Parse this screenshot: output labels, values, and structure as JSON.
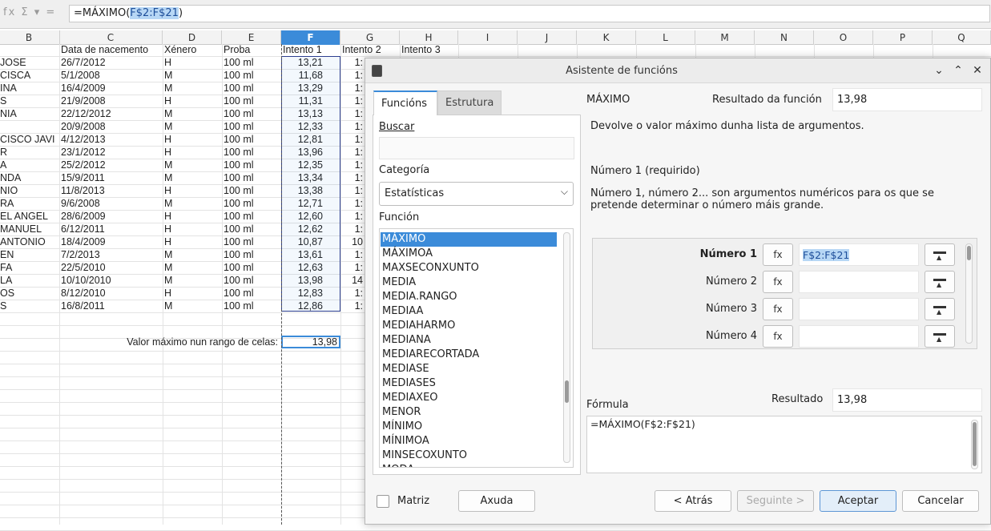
{
  "formula_bar": {
    "icons": "fx Σ ▾ =",
    "prefix": "=MÁXIMO(",
    "ref": "F$2:F$21",
    "suffix": ")"
  },
  "columns": [
    "B",
    "C",
    "D",
    "E",
    "F",
    "G",
    "H",
    "I",
    "J",
    "K",
    "L",
    "M",
    "N",
    "O",
    "P",
    "Q"
  ],
  "selected_column": "F",
  "sheet": {
    "headers": {
      "c": "Data de nacemento",
      "d": "Xénero",
      "e": "Proba",
      "f": "Intento 1",
      "g": "Intento 2",
      "h": "Intento 3"
    },
    "rows": [
      {
        "b": "JOSE",
        "c": "26/7/2012",
        "d": "H",
        "e": "100 ml",
        "f": "13,21",
        "g": "1:"
      },
      {
        "b": "CISCA",
        "c": "5/1/2008",
        "d": "M",
        "e": "100 ml",
        "f": "11,68",
        "g": "1:"
      },
      {
        "b": "INA",
        "c": "16/4/2009",
        "d": "M",
        "e": "100 ml",
        "f": "13,29",
        "g": "1:"
      },
      {
        "b": "S",
        "c": "21/9/2008",
        "d": "H",
        "e": "100 ml",
        "f": "11,31",
        "g": "1:"
      },
      {
        "b": "NIA",
        "c": "22/12/2012",
        "d": "M",
        "e": "100 ml",
        "f": "13,13",
        "g": "1:"
      },
      {
        "b": "",
        "c": "20/9/2008",
        "d": "M",
        "e": "100 ml",
        "f": "12,33",
        "g": "1:"
      },
      {
        "b": "CISCO JAVI",
        "c": "4/12/2013",
        "d": "H",
        "e": "100 ml",
        "f": "12,81",
        "g": "1:"
      },
      {
        "b": "R",
        "c": "23/1/2012",
        "d": "H",
        "e": "100 ml",
        "f": "13,96",
        "g": "1:"
      },
      {
        "b": "A",
        "c": "25/2/2012",
        "d": "M",
        "e": "100 ml",
        "f": "12,35",
        "g": "1:"
      },
      {
        "b": "NDA",
        "c": "15/9/2011",
        "d": "M",
        "e": "100 ml",
        "f": "13,34",
        "g": "1:"
      },
      {
        "b": "NIO",
        "c": "11/8/2013",
        "d": "H",
        "e": "100 ml",
        "f": "13,38",
        "g": "1:"
      },
      {
        "b": "RA",
        "c": "9/6/2008",
        "d": "M",
        "e": "100 ml",
        "f": "12,71",
        "g": "1:"
      },
      {
        "b": "EL ANGEL",
        "c": "28/6/2009",
        "d": "H",
        "e": "100 ml",
        "f": "12,60",
        "g": "1:"
      },
      {
        "b": "MANUEL",
        "c": "6/12/2011",
        "d": "H",
        "e": "100 ml",
        "f": "12,62",
        "g": "1:"
      },
      {
        "b": "ANTONIO",
        "c": "18/4/2009",
        "d": "H",
        "e": "100 ml",
        "f": "10,87",
        "g": "10"
      },
      {
        "b": "EN",
        "c": "7/2/2013",
        "d": "M",
        "e": "100 ml",
        "f": "13,61",
        "g": "1:"
      },
      {
        "b": "FA",
        "c": "22/5/2010",
        "d": "M",
        "e": "100 ml",
        "f": "12,63",
        "g": "1:"
      },
      {
        "b": "LA",
        "c": "10/10/2010",
        "d": "M",
        "e": "100 ml",
        "f": "13,98",
        "g": "14"
      },
      {
        "b": "OS",
        "c": "8/12/2010",
        "d": "H",
        "e": "100 ml",
        "f": "12,83",
        "g": "1:"
      },
      {
        "b": "S",
        "c": "16/8/2011",
        "d": "M",
        "e": "100 ml",
        "f": "12,86",
        "g": "1:"
      }
    ],
    "summary_label": "Valor máximo nun rango de celas:",
    "summary_value": "13,98"
  },
  "dialog": {
    "title": "Asistente de funcións",
    "tabs": [
      "Funcións",
      "Estrutura"
    ],
    "search_label": "Buscar",
    "search_value": "",
    "category_label": "Categoría",
    "category_value": "Estatísticas",
    "function_label": "Función",
    "functions": [
      "MÁXIMO",
      "MÁXIMOA",
      "MAXSECONXUNTO",
      "MEDIA",
      "MEDIA.RANGO",
      "MEDIAA",
      "MEDIAHARMO",
      "MEDIANA",
      "MEDIARECORTADA",
      "MEDIASE",
      "MEDIASES",
      "MEDIAXEO",
      "MENOR",
      "MÍNIMO",
      "MÍNIMOA",
      "MINSECOXUNTO",
      "MODA"
    ],
    "selected_function": "MÁXIMO",
    "func_name": "MÁXIMO",
    "result_label": "Resultado da función",
    "result_value": "13,98",
    "description": "Devolve o valor máximo dunha lista de argumentos.",
    "arg_title": "Número 1 (requirido)",
    "arg_desc": "Número 1, número 2... son argumentos numéricos para os que se pretende determinar o número máis grande.",
    "args": [
      {
        "label": "Número 1",
        "value": "F$2:F$21"
      },
      {
        "label": "Número 2",
        "value": ""
      },
      {
        "label": "Número 3",
        "value": ""
      },
      {
        "label": "Número 4",
        "value": ""
      }
    ],
    "fx_glyph": "fx",
    "formula_label": "Fórmula",
    "result2_label": "Resultado",
    "result2_value": "13,98",
    "formula_value": "=MÁXIMO(F$2:F$21)",
    "matrix_label": "Matriz",
    "help_button": "Axuda",
    "back_button": "< Atrás",
    "next_button": "Seguinte >",
    "ok_button": "Aceptar",
    "cancel_button": "Cancelar",
    "win_buttons": [
      "⌄",
      "⌃",
      "✕"
    ]
  }
}
